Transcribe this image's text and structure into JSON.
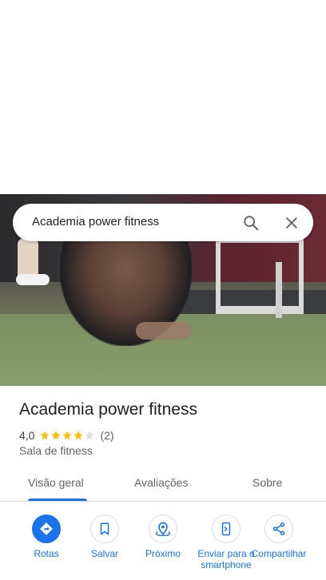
{
  "search": {
    "query": "Academia power fitness"
  },
  "place": {
    "name": "Academia power fitness",
    "rating": "4,0",
    "stars": 4,
    "review_count": "(2)",
    "category": "Sala de fitness"
  },
  "tabs": [
    {
      "label": "Visão geral",
      "active": true
    },
    {
      "label": "Avaliações",
      "active": false
    },
    {
      "label": "Sobre",
      "active": false
    }
  ],
  "actions": [
    {
      "label": "Rotas",
      "icon": "directions-icon"
    },
    {
      "label": "Salvar",
      "icon": "bookmark-icon"
    },
    {
      "label": "Próximo",
      "icon": "nearby-icon"
    },
    {
      "label": "Enviar para o smartphone",
      "icon": "send-to-phone-icon"
    },
    {
      "label": "Compartilhar",
      "icon": "share-icon"
    }
  ],
  "colors": {
    "accent": "#1a73e8",
    "star": "#fbbc04",
    "star_empty": "#dadce0"
  }
}
